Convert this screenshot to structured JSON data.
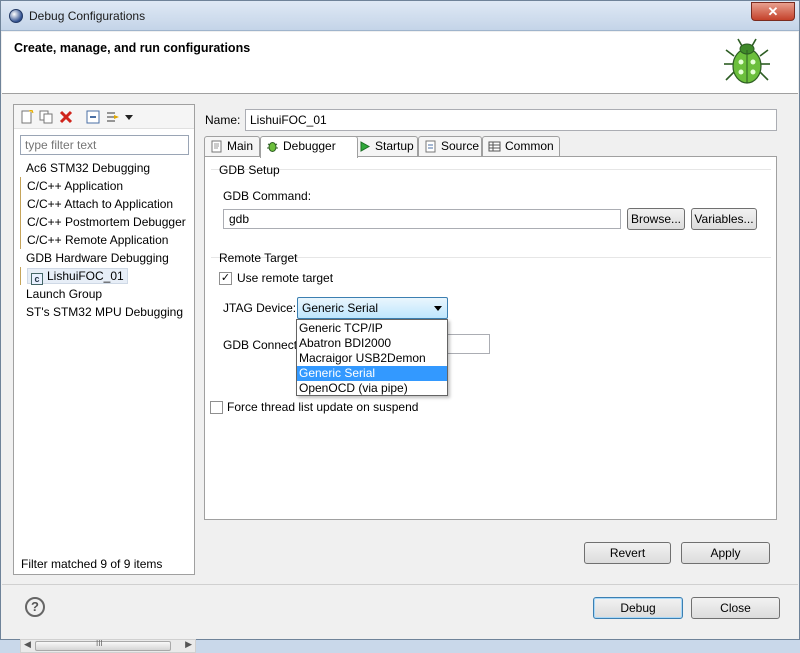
{
  "window": {
    "title": "Debug Configurations",
    "close_symbol": "✕"
  },
  "header": {
    "heading": "Create, manage, and run configurations"
  },
  "left": {
    "filter_placeholder": "type filter text",
    "tree": [
      {
        "label": "Ac6 STM32 Debugging",
        "child": false
      },
      {
        "label": "C/C++ Application",
        "child": true
      },
      {
        "label": "C/C++ Attach to Application",
        "child": true
      },
      {
        "label": "C/C++ Postmortem Debugger",
        "child": true
      },
      {
        "label": "C/C++ Remote Application",
        "child": true
      },
      {
        "label": "GDB Hardware Debugging",
        "child": false
      },
      {
        "label": "LishuiFOC_01",
        "child": true,
        "selected": true,
        "icon": "c-config-icon"
      },
      {
        "label": "Launch Group",
        "child": false
      },
      {
        "label": "ST's STM32 MPU Debugging",
        "child": false
      }
    ],
    "scroll_label": "III",
    "status": "Filter matched 9 of 9 items"
  },
  "config": {
    "name_label": "Name:",
    "name_value": "LishuiFOC_01",
    "tabs": [
      {
        "label": "Main",
        "icon": "main-tab-icon"
      },
      {
        "label": "Debugger",
        "icon": "bug-tab-icon",
        "active": true
      },
      {
        "label": "Startup",
        "icon": "play-icon"
      },
      {
        "label": "Source",
        "icon": "source-icon"
      },
      {
        "label": "Common",
        "icon": "table-icon"
      }
    ],
    "gdb_setup": {
      "title": "GDB Setup",
      "command_label": "GDB Command:",
      "command_value": "gdb",
      "browse": "Browse...",
      "variables": "Variables..."
    },
    "remote": {
      "title": "Remote Target",
      "use_remote_label": "Use remote target",
      "use_remote_checked": true,
      "jtag_label": "JTAG Device:",
      "jtag_value": "Generic Serial",
      "gdb_connection_label": "GDB Connecti",
      "options": [
        "Generic TCP/IP",
        "Abatron BDI2000",
        "Macraigor USB2Demon",
        "Generic Serial",
        "OpenOCD (via pipe)"
      ],
      "selected_option": 3
    },
    "force_thread_label": "Force thread list update on suspend",
    "revert": "Revert",
    "apply": "Apply"
  },
  "footer": {
    "debug": "Debug",
    "close": "Close",
    "help": "?"
  }
}
